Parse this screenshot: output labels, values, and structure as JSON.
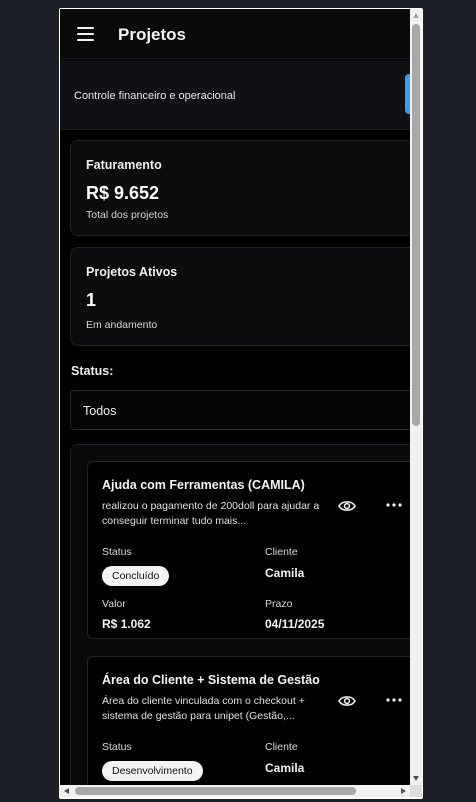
{
  "header": {
    "title": "Projetos",
    "menu_icon": "hamburger-menu-icon"
  },
  "subheader": {
    "text": "Controle financeiro e operacional",
    "accent": "#3a9df0"
  },
  "stats": [
    {
      "title": "Faturamento",
      "value": "R$ 9.652",
      "sub": "Total dos projetos"
    },
    {
      "title": "Projetos Ativos",
      "value": "1",
      "sub": "Em andamento"
    }
  ],
  "filter": {
    "label": "Status:",
    "selected": "Todos"
  },
  "field_labels": {
    "status": "Status",
    "client": "Cliente",
    "value": "Valor",
    "deadline": "Prazo"
  },
  "projects": [
    {
      "title": "Ajuda com Ferramentas (CAMILA)",
      "description": "realizou o pagamento de 200doll para ajudar a conseguir terminar tudo mais...",
      "status": "Concluído",
      "client": "Camila",
      "value": "R$ 1.062",
      "deadline": "04/11/2025"
    },
    {
      "title": "Área do Cliente + Sistema de Gestão",
      "description": "Área do cliente vinculada com o checkout + sistema de gestão para unipet (Gestão,...",
      "status": "Desenvolvimento",
      "client": "Camila"
    }
  ]
}
